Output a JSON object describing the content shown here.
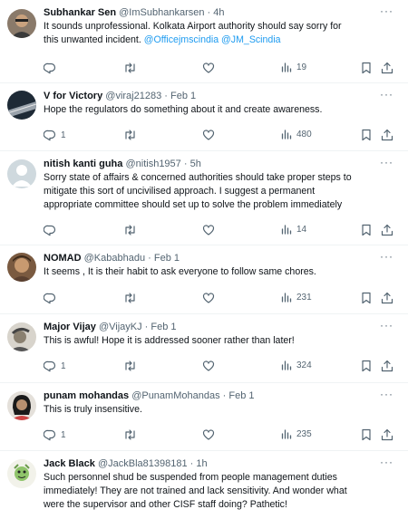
{
  "tweets": [
    {
      "name": "Subhankar Sen",
      "handle": "@ImSubhankarsen",
      "time": "4h",
      "text_lines": [
        "It sounds unprofessional. Kolkata Airport authority should say sorry for",
        "this unwanted incident. "
      ],
      "mentions": "@Officejmscindia @JM_Scindia",
      "replies": "",
      "views": "19"
    },
    {
      "name": "V for Victory",
      "handle": "@viraj21283",
      "time": "Feb 1",
      "text_lines": [
        "Hope the regulators do something about it and create awareness."
      ],
      "replies": "1",
      "views": "480"
    },
    {
      "name": "nitish kanti guha",
      "handle": "@nitish1957",
      "time": "5h",
      "text_lines": [
        "Sorry state of affairs & concerned authorities should take proper steps to",
        "mitigate this sort of uncivilised approach. I suggest a permanent",
        "appropriate committee should set up to solve the  problem immediately"
      ],
      "replies": "",
      "views": "14"
    },
    {
      "name": "NOMAD",
      "handle": "@Kababhadu",
      "time": "Feb 1",
      "text_lines": [
        "It seems , It is their habit to ask everyone to follow same chores."
      ],
      "replies": "",
      "views": "231"
    },
    {
      "name": "Major Vijay",
      "handle": "@VijayKJ",
      "time": "Feb 1",
      "text_lines": [
        "This is awful! Hope it is addressed sooner rather than later!"
      ],
      "replies": "1",
      "views": "324"
    },
    {
      "name": "punam mohandas",
      "handle": "@PunamMohandas",
      "time": "Feb 1",
      "text_lines": [
        "This is truly insensitive."
      ],
      "replies": "1",
      "views": "235"
    },
    {
      "name": "Jack Black",
      "handle": "@JackBla81398181",
      "time": "1h",
      "text_lines": [
        "Such personnel shud be suspended from people management duties",
        "immediately! They are not trained and lack sensitivity. And wonder what",
        "were the supervisor and other CISF staff doing? Pathetic!"
      ],
      "replies": "",
      "views": ""
    }
  ],
  "separator": "·",
  "more_glyph": "···",
  "icons": [
    "reply-icon",
    "retweet-icon",
    "like-icon",
    "views-icon",
    "bookmark-icon",
    "share-icon"
  ],
  "colors": {
    "muted": "#536471",
    "link": "#1d9bf0",
    "text": "#0f1419",
    "divider": "#eff3f4"
  }
}
